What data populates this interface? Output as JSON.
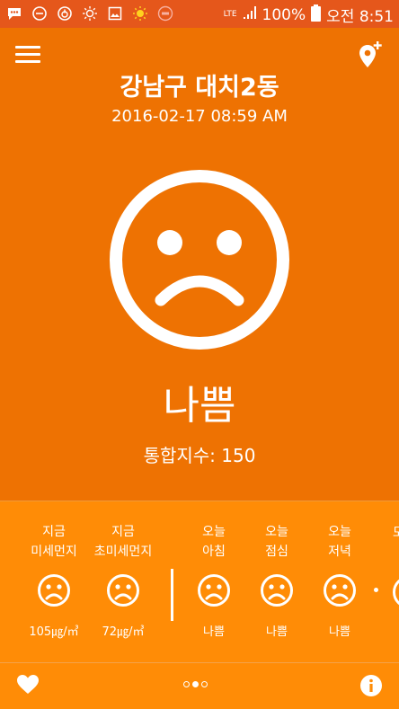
{
  "statusbar": {
    "network": "LTE",
    "battery": "100%",
    "time": "오전 8:51"
  },
  "header": {
    "title": "강남구 대치2동",
    "datetime": "2016-02-17 08:59 AM"
  },
  "summary": {
    "status": "나쁨",
    "index_text": "통합지수: 150",
    "face": "sad-face-icon"
  },
  "forecast": {
    "items": [
      {
        "label1": "지금",
        "label2": "미세먼지",
        "value": "105㎍/㎥",
        "face": "sad-face-icon"
      },
      {
        "label1": "지금",
        "label2": "초미세먼지",
        "value": "72㎍/㎥",
        "face": "sad-face-icon"
      },
      {
        "label1": "오늘",
        "label2": "아침",
        "value": "나쁨",
        "face": "sad-face-icon"
      },
      {
        "label1": "오늘",
        "label2": "점심",
        "value": "나쁨",
        "face": "sad-face-icon"
      },
      {
        "label1": "오늘",
        "label2": "저녁",
        "value": "나쁨",
        "face": "sad-face-icon"
      }
    ],
    "partial_label": "모"
  },
  "colors": {
    "status_bar": "#e5571b",
    "main_bg": "#ee7202",
    "strip_bg": "#ff8c06"
  },
  "pager": {
    "count": 3,
    "active": 1
  }
}
